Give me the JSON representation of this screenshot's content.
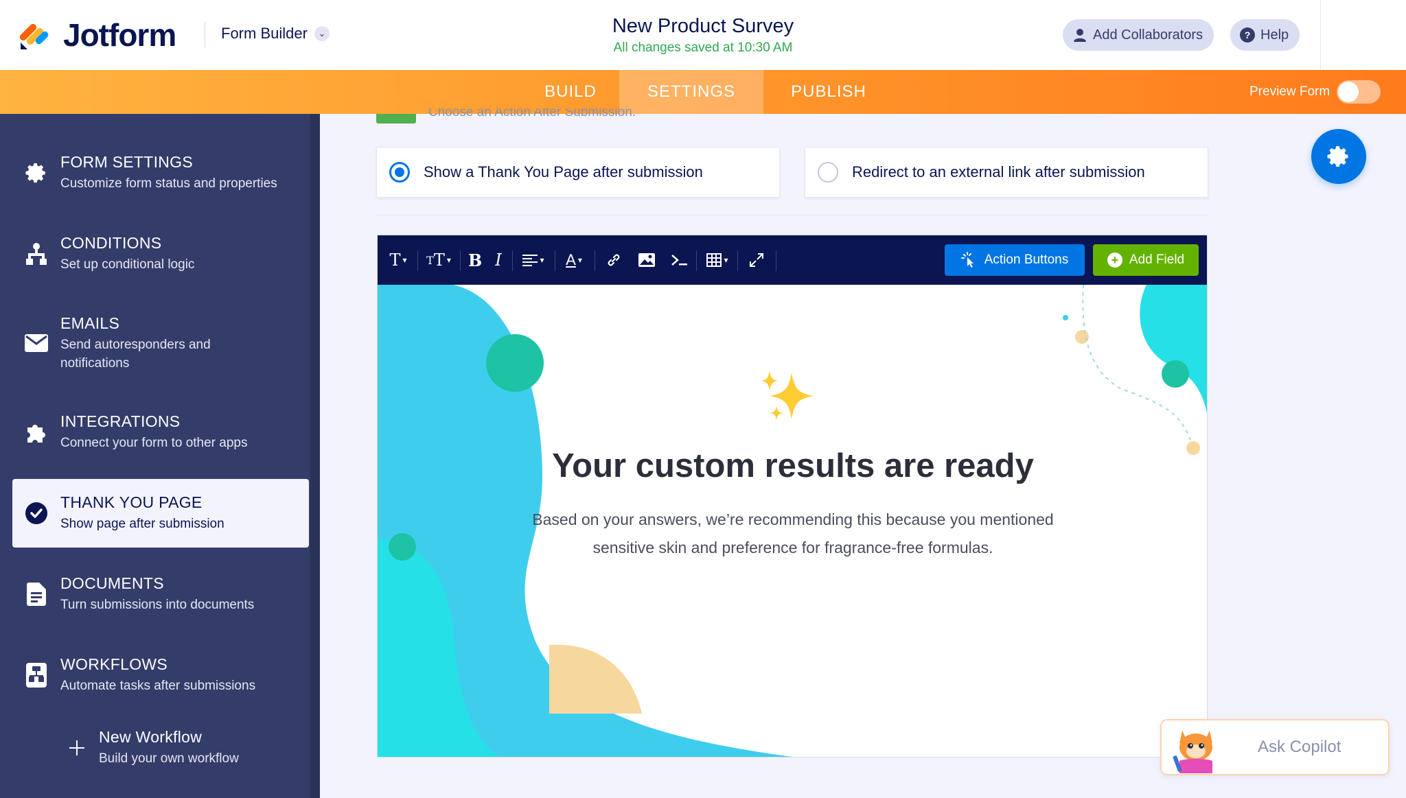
{
  "app": {
    "logo_text": "Jotform",
    "builder_label": "Form Builder",
    "form_title": "New Product Survey",
    "save_status": "All changes saved at 10:30 AM",
    "add_collaborators": "Add Collaborators",
    "help": "Help"
  },
  "nav": {
    "tabs": [
      {
        "label": "BUILD"
      },
      {
        "label": "SETTINGS"
      },
      {
        "label": "PUBLISH"
      }
    ],
    "active_tab": "SETTINGS",
    "preview_label": "Preview Form",
    "preview_enabled": false
  },
  "sidebar": {
    "items": [
      {
        "title": "FORM SETTINGS",
        "subtitle": "Customize form status and properties",
        "icon": "gear-icon"
      },
      {
        "title": "CONDITIONS",
        "subtitle": "Set up conditional logic",
        "icon": "conditions-icon"
      },
      {
        "title": "EMAILS",
        "subtitle": "Send autoresponders and notifications",
        "icon": "envelope-icon"
      },
      {
        "title": "INTEGRATIONS",
        "subtitle": "Connect your form to other apps",
        "icon": "puzzle-icon"
      },
      {
        "title": "THANK YOU PAGE",
        "subtitle": "Show page after submission",
        "icon": "check-circle-icon"
      },
      {
        "title": "DOCUMENTS",
        "subtitle": "Turn submissions into documents",
        "icon": "document-icon"
      },
      {
        "title": "WORKFLOWS",
        "subtitle": "Automate tasks after submissions",
        "icon": "workflow-icon"
      }
    ],
    "active_index": 4,
    "new_workflow": {
      "title": "New Workflow",
      "subtitle": "Build your own workflow"
    }
  },
  "main": {
    "partial_heading": "Choose an Action After Submission.",
    "options": [
      {
        "label": "Show a Thank You Page after submission",
        "selected": true
      },
      {
        "label": "Redirect to an external link after submission",
        "selected": false
      }
    ],
    "toolbar": {
      "action_buttons": "Action Buttons",
      "add_field": "Add Field"
    },
    "thankyou": {
      "heading": "Your custom results are ready",
      "body_line1": "Based on your answers, we’re recommending this because you mentioned",
      "body_line2": "sensitive skin and preference for fragrance-free formulas."
    }
  },
  "copilot": {
    "label": "Ask Copilot"
  },
  "colors": {
    "navy": "#0a1551",
    "orange_start": "#ffb340",
    "orange_end": "#ff7b1c",
    "blue": "#0075e3",
    "green": "#64b200",
    "sidebar": "#343c6a",
    "saved_green": "#31a850"
  }
}
